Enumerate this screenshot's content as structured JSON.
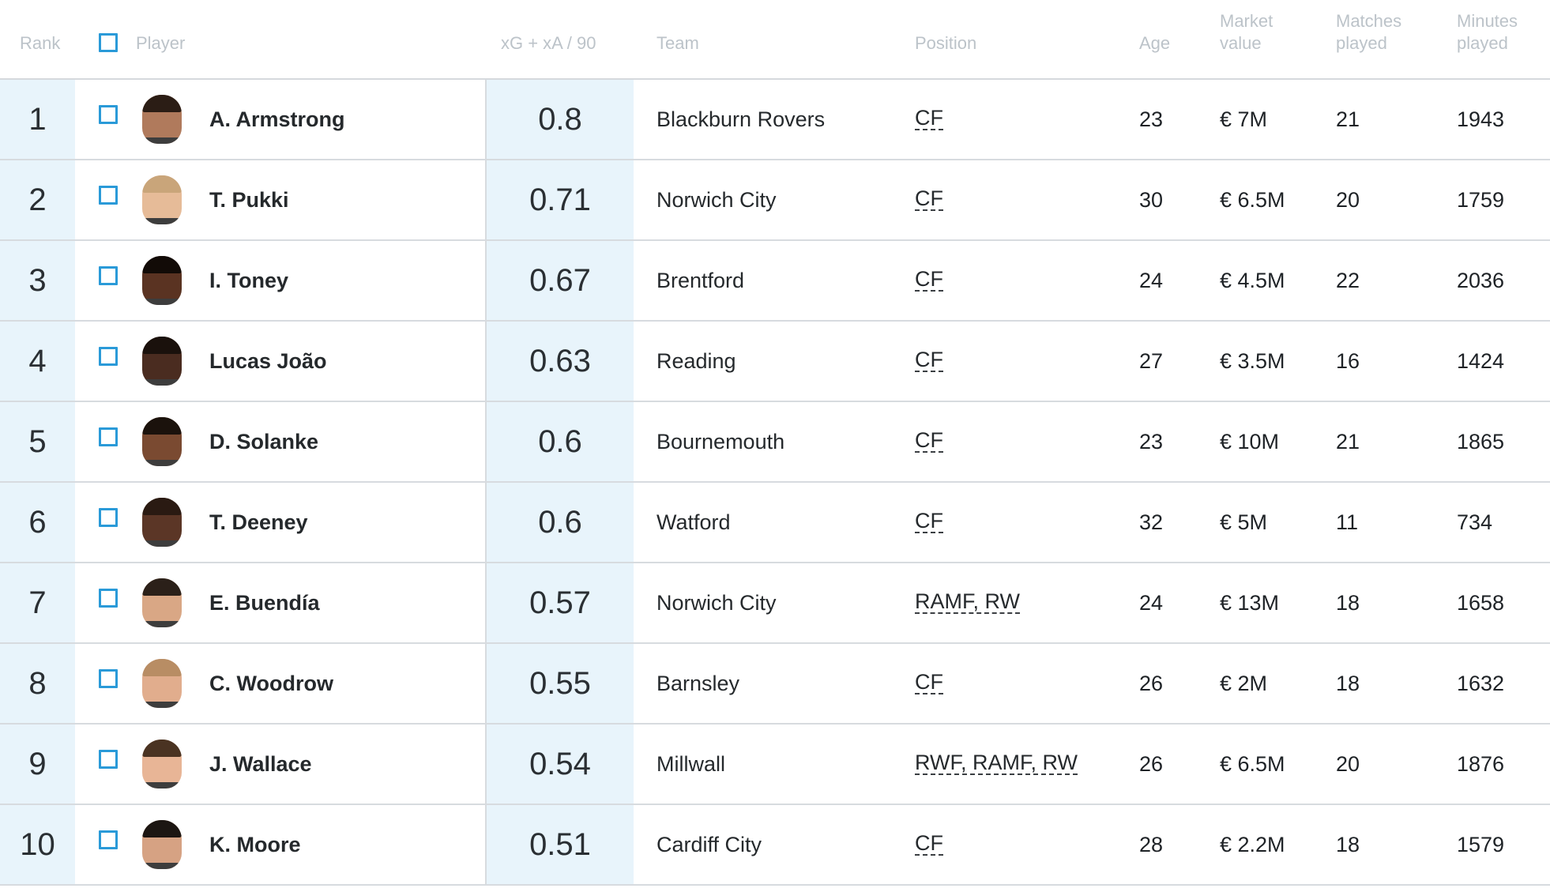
{
  "header": {
    "rank": "Rank",
    "player": "Player",
    "metric": "xG + xA /  90",
    "team": "Team",
    "position": "Position",
    "age": "Age",
    "market_value_l1": "Market",
    "market_value_l2": "value",
    "matches_l1": "Matches",
    "matches_l2": "played",
    "minutes_l1": "Minutes",
    "minutes_l2": "played"
  },
  "colors": {
    "highlight_column": "#e8f4fb",
    "checkbox_border": "#2a9ad8",
    "header_text": "#bcc3c9"
  },
  "rows": [
    {
      "rank": "1",
      "name": "A. Armstrong",
      "metric": "0.8",
      "team": "Blackburn Rovers",
      "position": "CF",
      "age": "23",
      "market_value": "€ 7M",
      "matches": "21",
      "minutes": "1943",
      "skin": "#b07a5c",
      "hair": "#2b1d15"
    },
    {
      "rank": "2",
      "name": "T. Pukki",
      "metric": "0.71",
      "team": "Norwich City",
      "position": "CF",
      "age": "30",
      "market_value": "€ 6.5M",
      "matches": "20",
      "minutes": "1759",
      "skin": "#e6bb98",
      "hair": "#c9a57a"
    },
    {
      "rank": "3",
      "name": "I. Toney",
      "metric": "0.67",
      "team": "Brentford",
      "position": "CF",
      "age": "24",
      "market_value": "€ 4.5M",
      "matches": "22",
      "minutes": "2036",
      "skin": "#5a3322",
      "hair": "#120b07"
    },
    {
      "rank": "4",
      "name": "Lucas João",
      "metric": "0.63",
      "team": "Reading",
      "position": "CF",
      "age": "27",
      "market_value": "€ 3.5M",
      "matches": "16",
      "minutes": "1424",
      "skin": "#4a2c20",
      "hair": "#1a110c"
    },
    {
      "rank": "5",
      "name": "D. Solanke",
      "metric": "0.6",
      "team": "Bournemouth",
      "position": "CF",
      "age": "23",
      "market_value": "€ 10M",
      "matches": "21",
      "minutes": "1865",
      "skin": "#7a4a31",
      "hair": "#1b120c"
    },
    {
      "rank": "6",
      "name": "T. Deeney",
      "metric": "0.6",
      "team": "Watford",
      "position": "CF",
      "age": "32",
      "market_value": "€ 5M",
      "matches": "11",
      "minutes": "734",
      "skin": "#5b3626",
      "hair": "#2a1a12"
    },
    {
      "rank": "7",
      "name": "E. Buendía",
      "metric": "0.57",
      "team": "Norwich City",
      "position": "RAMF, RW",
      "age": "24",
      "market_value": "€ 13M",
      "matches": "18",
      "minutes": "1658",
      "skin": "#d9a785",
      "hair": "#2b2019"
    },
    {
      "rank": "8",
      "name": "C. Woodrow",
      "metric": "0.55",
      "team": "Barnsley",
      "position": "CF",
      "age": "26",
      "market_value": "€ 2M",
      "matches": "18",
      "minutes": "1632",
      "skin": "#e1ad8d",
      "hair": "#b88d64"
    },
    {
      "rank": "9",
      "name": "J. Wallace",
      "metric": "0.54",
      "team": "Millwall",
      "position": "RWF, RAMF, RW",
      "age": "26",
      "market_value": "€ 6.5M",
      "matches": "20",
      "minutes": "1876",
      "skin": "#e8b596",
      "hair": "#4a3322"
    },
    {
      "rank": "10",
      "name": "K. Moore",
      "metric": "0.51",
      "team": "Cardiff City",
      "position": "CF",
      "age": "28",
      "market_value": "€ 2.2M",
      "matches": "18",
      "minutes": "1579",
      "skin": "#d6a283",
      "hair": "#1c1612"
    }
  ]
}
